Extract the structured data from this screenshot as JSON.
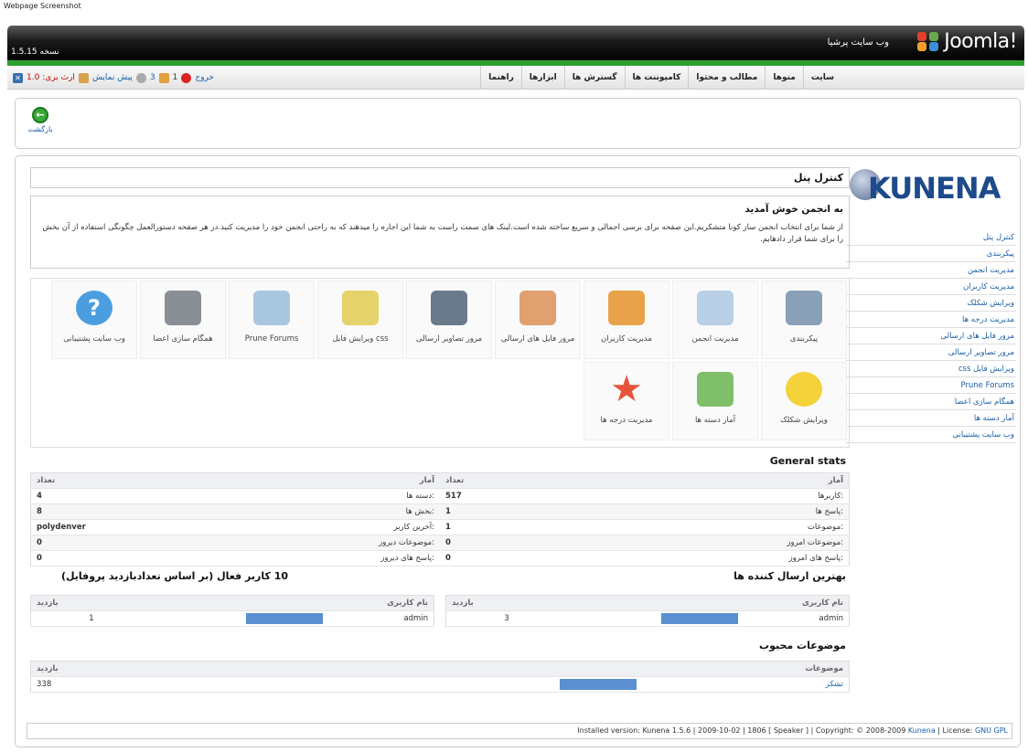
{
  "caption": "Webpage Screenshot",
  "header": {
    "version": "1.5.15 نسخه",
    "site_name": "وب سایت پرشیا",
    "logo": "Joomla!"
  },
  "menu": {
    "items": [
      "سایت",
      "منوها",
      "مطالب و محتوا",
      "کامپوننت ها",
      "گسترش ها",
      "ابزارها",
      "راهنما"
    ],
    "status": {
      "logout": "خروج",
      "users_online": "1",
      "messages": "3",
      "preview": "پیش نمایش",
      "version_label": "ارث برى:",
      "version_value": "1.0"
    }
  },
  "toolbar": {
    "back_label": "بازگشت"
  },
  "sidebar": {
    "logo_text": "KUNENA",
    "items": [
      "کنترل پنل",
      "پیکربندی",
      "مدیریت انجمن",
      "مدیریت کاربران",
      "ویرایش شکلک",
      "مدیریت درجه ها",
      "مرور فایل های ارسالی",
      "مرور تصاویر ارسالی",
      "ویرایش فایل css",
      "Prune Forums",
      "همگام سازی اعضا",
      "آمار دسته ها",
      "وب سایت پشتیبانی"
    ]
  },
  "panel": {
    "title": "کنترل پنل",
    "welcome_title": "به انجمن خوش آمدید",
    "welcome_text": "از شما برای انتخاب انجمن ساز کونا متشکریم.این صفحه برای برسی اجمالی و سریع ساخته شده است.لینک های سمت راست به شما این اجاره را میدهند که به راحتی انجمن خود را مدیریت کنید.در هر صفحه دستورالعمل چگونگی استفاده از آن بخش را برای شما قرار دادهایم."
  },
  "icons": [
    {
      "label": "پیکربندی",
      "icon": "wrench-icon",
      "color": "#8aa0b8"
    },
    {
      "label": "مدیریت انجمن",
      "icon": "forum-window-icon",
      "color": "#b8cfe6"
    },
    {
      "label": "مدیریت کاربران",
      "icon": "users-icon",
      "color": "#e8a24a"
    },
    {
      "label": "مرور فایل های ارسالی",
      "icon": "files-icon",
      "color": "#e0a070"
    },
    {
      "label": "مرور تصاویر ارسالی",
      "icon": "camera-icon",
      "color": "#6a7a8a"
    },
    {
      "label": "ویرایش فایل css",
      "icon": "css-edit-icon",
      "color": "#e6d26a"
    },
    {
      "label": "Prune Forums",
      "icon": "prune-clock-icon",
      "color": "#a9c6e0"
    },
    {
      "label": "همگام سازی اعضا",
      "icon": "user-sync-icon",
      "color": "#8a8f96"
    },
    {
      "label": "وب سایت پشتیبانی",
      "icon": "help-icon",
      "color": "#4a9ee0"
    },
    {
      "label": "ویرایش شکلک",
      "icon": "smiley-icon",
      "color": "#f3d23a"
    },
    {
      "label": "آمار دسته ها",
      "icon": "refresh-stats-icon",
      "color": "#7fbf6a"
    },
    {
      "label": "مدیریت درجه ها",
      "icon": "star-icon",
      "color": "#e8543a"
    }
  ],
  "stats": {
    "title": "General stats",
    "headers": [
      "آمار",
      "تعداد",
      "آمار",
      "تعداد"
    ],
    "rows": [
      [
        "کاربرها:",
        "517",
        "دسته ها:",
        "4"
      ],
      [
        "پاسخ ها:",
        "1",
        "بخش ها:",
        "8"
      ],
      [
        "موضوعات:",
        "1",
        "آخرین کاربر:",
        "polydenver"
      ],
      [
        "موضوعات امروز:",
        "0",
        "موضوعات دیروز:",
        "0"
      ],
      [
        "پاسخ های امروز:",
        "0",
        "پاسخ های دیروز:",
        "0"
      ]
    ]
  },
  "top_posters": {
    "title": "بهترین ارسال کننده ها",
    "headers": [
      "نام کاربری",
      "",
      "بازدید"
    ],
    "rows": [
      {
        "user": "admin",
        "value": "3",
        "fill": 1.0
      }
    ]
  },
  "top_active": {
    "title": "10 کاربر فعال (بر اساس تعدادبازدید پروفایل)",
    "headers": [
      "نام کاربری",
      "",
      "بازدید"
    ],
    "rows": [
      {
        "user": "admin",
        "value": "1",
        "fill": 1.0
      }
    ]
  },
  "popular": {
    "title": "موضوعات محبوب",
    "headers": [
      "موضوعات",
      "",
      "بازدید"
    ],
    "rows": [
      {
        "topic": "تشکر",
        "value": "338",
        "fill": 1.0
      }
    ]
  },
  "footer": {
    "text": "Installed version: Kunena 1.5.6 | 2009-10-02 | 1806 [ Speaker ] | Copyright: © 2008-2009",
    "link1": "Kunena",
    "mid": "| License:",
    "link2": "GNU GPL"
  },
  "colors": {
    "accent_green": "#2ea02e",
    "bar_blue": "#5b8fd0",
    "link": "#1a5fa5"
  }
}
